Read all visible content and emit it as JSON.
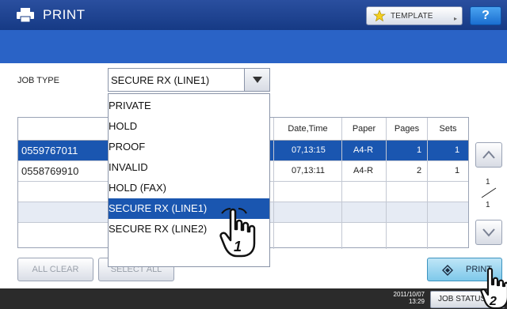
{
  "header": {
    "title": "PRINT",
    "template_label": "TEMPLATE",
    "help_label": "?"
  },
  "job_type": {
    "label": "JOB TYPE",
    "selected": "SECURE RX (LINE1)",
    "options": [
      "PRIVATE",
      "HOLD",
      "PROOF",
      "INVALID",
      "HOLD (FAX)",
      "SECURE RX (LINE1)",
      "SECURE RX (LINE2)"
    ],
    "highlighted_index": 5
  },
  "table": {
    "columns": [
      "",
      "",
      "Date,Time",
      "Paper",
      "Pages",
      "Sets"
    ],
    "rows": [
      {
        "id": "0559767011",
        "datetime": "07,13:15",
        "paper": "A4-R",
        "pages": "1",
        "sets": "1",
        "selected": true
      },
      {
        "id": "0558769910",
        "datetime": "07,13:11",
        "paper": "A4-R",
        "pages": "2",
        "sets": "1",
        "selected": false
      }
    ]
  },
  "pagination": {
    "current": "1",
    "total": "1"
  },
  "buttons": {
    "all_clear": "ALL CLEAR",
    "select_all": "SELECT ALL",
    "print": "PRINT",
    "job_status": "JOB STATUS"
  },
  "clock": {
    "date": "2011/10/07",
    "time": "13:29"
  },
  "callouts": {
    "step1": "1",
    "step2": "2"
  },
  "colors": {
    "title_bar": "#1e4494",
    "sub_bar": "#2a63c6",
    "selection": "#1a56b0",
    "print_button": "#9fd8f2",
    "help_button": "#2a86e0"
  },
  "icons": [
    "printer-icon",
    "star-icon",
    "help-icon",
    "dropdown-arrow-icon",
    "scroll-up-icon",
    "scroll-down-icon",
    "print-diamond-icon",
    "hand-pointer-icon"
  ]
}
